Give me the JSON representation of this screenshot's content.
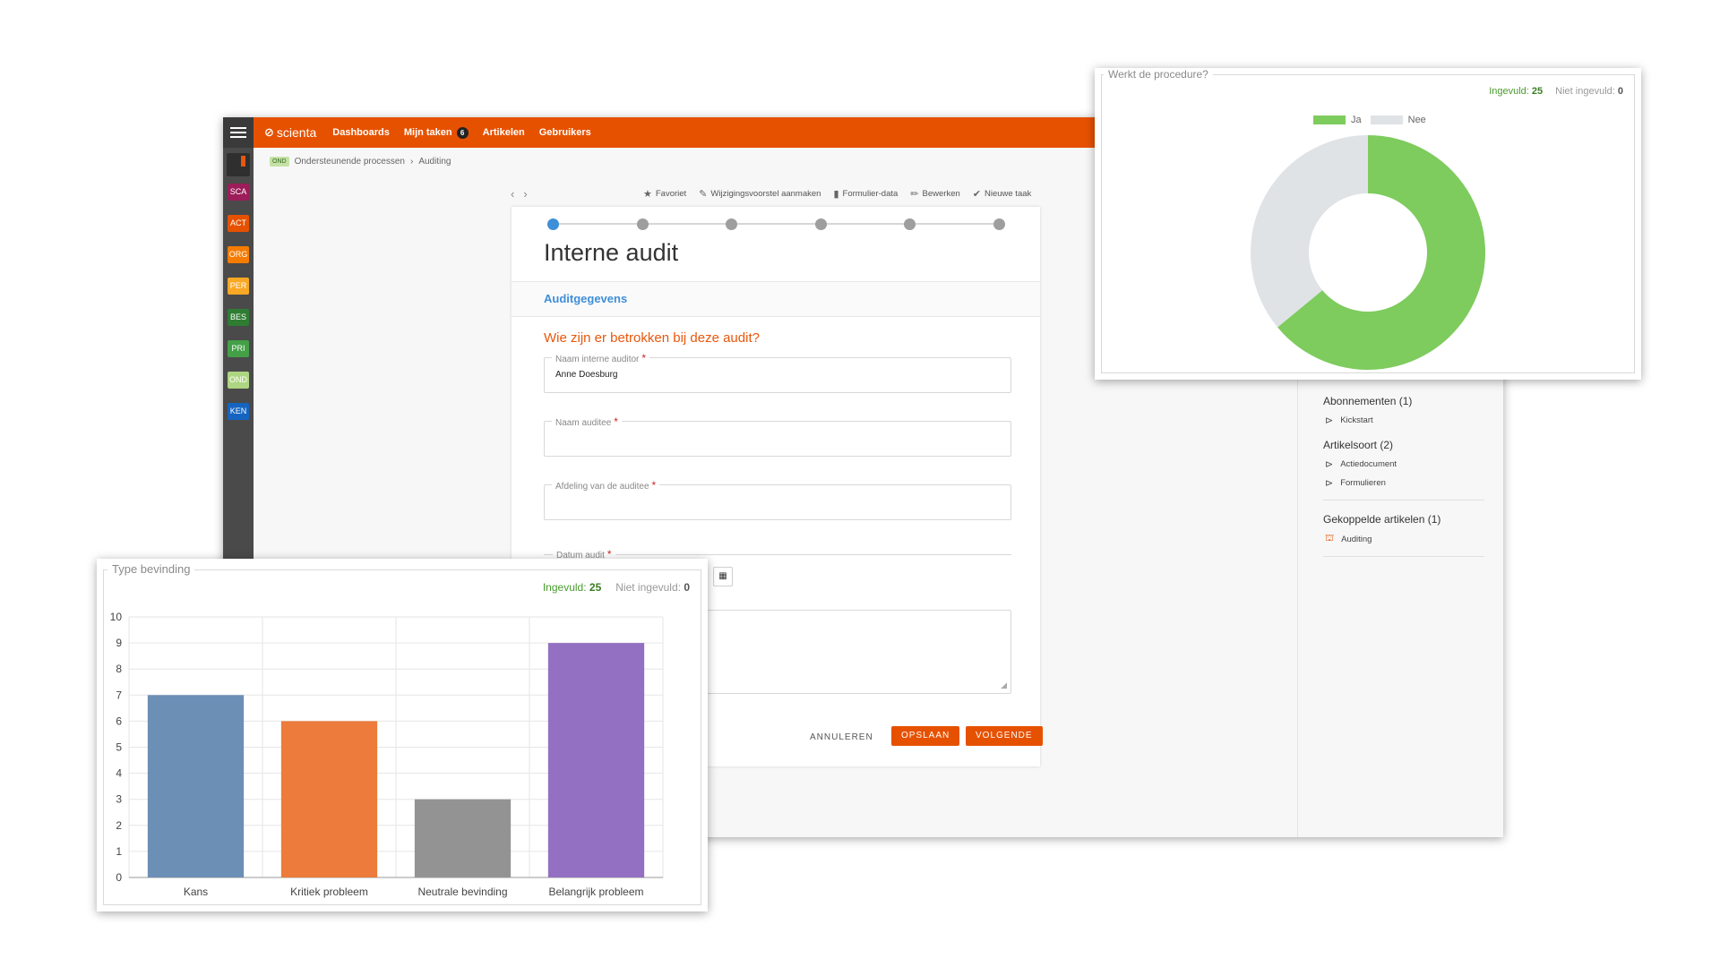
{
  "app": {
    "brand": "scienta",
    "nav": [
      {
        "label": "Dashboards"
      },
      {
        "label": "Mijn taken",
        "count": "6"
      },
      {
        "label": "Artikelen"
      },
      {
        "label": "Gebruikers"
      }
    ],
    "rail_badges": [
      {
        "label": "SCA",
        "color": "#9c1d5a"
      },
      {
        "label": "ACT",
        "color": "#e65100"
      },
      {
        "label": "ORG",
        "color": "#f57c00"
      },
      {
        "label": "PER",
        "color": "#f9a825"
      },
      {
        "label": "BES",
        "color": "#2e7d32"
      },
      {
        "label": "PRI",
        "color": "#43a047"
      },
      {
        "label": "OND",
        "color": "#aed581"
      },
      {
        "label": "KEN",
        "color": "#1565c0"
      }
    ],
    "breadcrumb": {
      "badge": "OND",
      "items": [
        "Ondersteunende processen",
        "Auditing"
      ],
      "separator": "›"
    },
    "pager": {
      "prev": "‹",
      "next": "›"
    },
    "toolbar": [
      {
        "icon": "star-icon",
        "glyph": "★",
        "label": "Favoriet"
      },
      {
        "icon": "edit-document-icon",
        "glyph": "✎",
        "label": "Wijzigingsvoorstel aanmaken"
      },
      {
        "icon": "bar-chart-icon",
        "glyph": "▮",
        "label": "Formulier-data"
      },
      {
        "icon": "pencil-icon",
        "glyph": "✏",
        "label": "Bewerken"
      },
      {
        "icon": "check-task-icon",
        "glyph": "✔",
        "label": "Nieuwe taak"
      }
    ],
    "accent_color": "#e65100"
  },
  "form": {
    "title": "Interne audit",
    "section": "Auditgegevens",
    "question": "Wie zijn er betrokken bij deze audit?",
    "step_count": 6,
    "active_step": 0,
    "fields": [
      {
        "label": "Naam interne auditor",
        "value": "Anne Doesburg"
      },
      {
        "label": "Naam auditee",
        "value": ""
      },
      {
        "label": "Afdeling van de auditee",
        "value": ""
      }
    ],
    "date_label": "Datum audit",
    "required_mark": "*",
    "buttons": {
      "cancel": "ANNULEREN",
      "save": "OPSLAAN",
      "next": "VOLGENDE"
    }
  },
  "right_panel": {
    "groups": [
      {
        "heading": "Abonnementen (1)",
        "items": [
          "Kickstart"
        ]
      },
      {
        "heading": "Artikelsoort (2)",
        "items": [
          "Actiedocument",
          "Formulieren"
        ]
      },
      {
        "heading": "Gekoppelde artikelen (1)",
        "items": [
          "Auditing"
        ]
      }
    ]
  },
  "donut_widget": {
    "title": "Werkt de procedure?",
    "filled_label": "Ingevuld:",
    "filled_value": "25",
    "not_filled_label": "Niet ingevuld:",
    "not_filled_value": "0"
  },
  "bar_widget": {
    "title": "Type bevinding",
    "filled_label": "Ingevuld:",
    "filled_value": "25",
    "not_filled_label": "Niet ingevuld:",
    "not_filled_value": "0"
  },
  "chart_data": [
    {
      "type": "pie",
      "title": "Werkt de procedure?",
      "donut": true,
      "legend_position": "top-center",
      "series": [
        {
          "name": "Ja",
          "value": 16,
          "color": "#7ecb5e"
        },
        {
          "name": "Nee",
          "value": 9,
          "color": "#dfe3e6"
        }
      ]
    },
    {
      "type": "bar",
      "title": "Type bevinding",
      "categories": [
        "Kans",
        "Kritiek probleem",
        "Neutrale bevinding",
        "Belangrijk probleem"
      ],
      "values": [
        7,
        6,
        3,
        9
      ],
      "colors": [
        "#6b8fb5",
        "#ec7b3c",
        "#939393",
        "#9370c2"
      ],
      "ylim": [
        0,
        10
      ],
      "yticks": [
        "0",
        "1",
        "2",
        "3",
        "4",
        "5",
        "6",
        "7",
        "8",
        "9",
        "10"
      ],
      "grid": true,
      "xlabel": "",
      "ylabel": ""
    }
  ]
}
